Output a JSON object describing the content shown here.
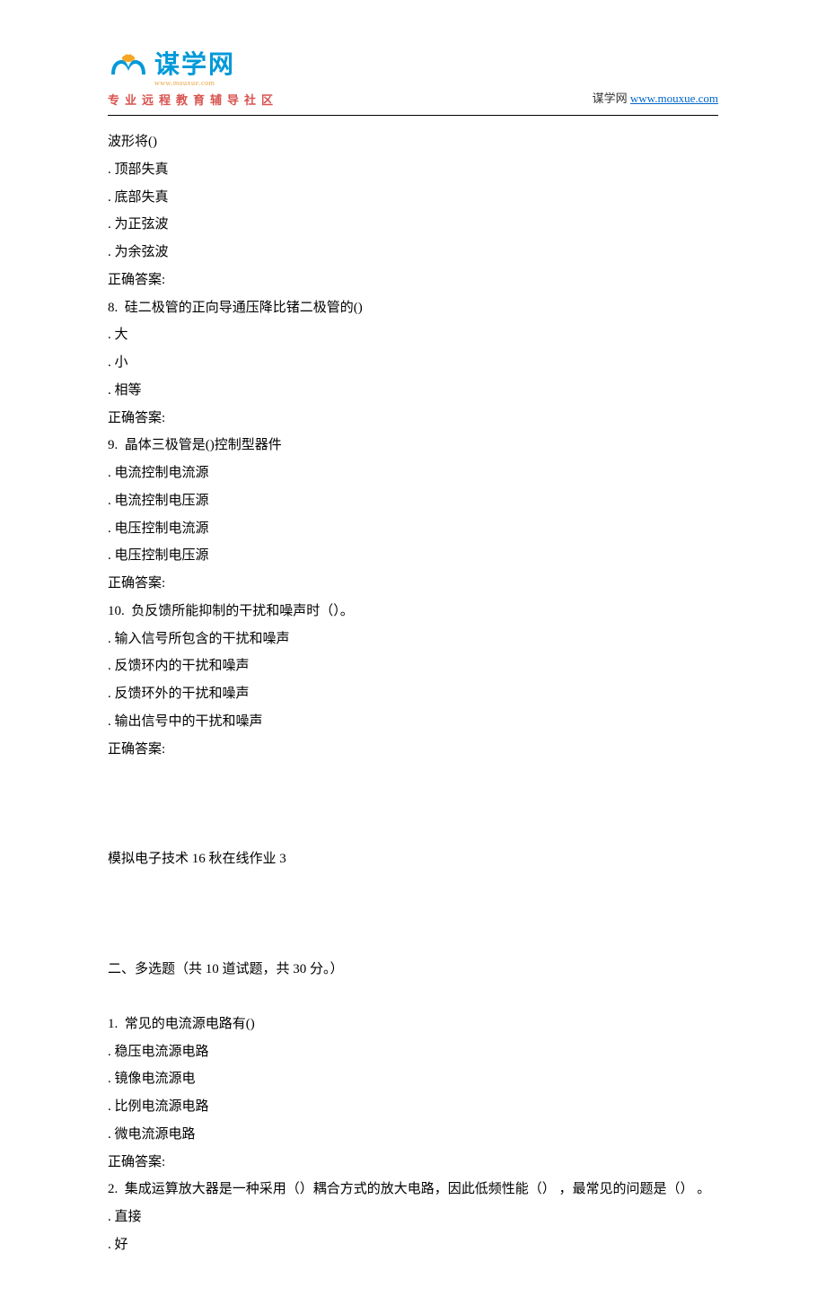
{
  "header": {
    "logo_main": "谋学网",
    "logo_sub": "www.mouxue.com",
    "logo_slogan": "专业远程教育辅导社区",
    "site_label": "谋学网",
    "site_url": "www.mouxue.com"
  },
  "lines": [
    "波形将()",
    ". 顶部失真",
    ". 底部失真",
    ". 为正弦波",
    ". 为余弦波",
    "正确答案:",
    "8.  硅二极管的正向导通压降比锗二极管的()",
    ". 大",
    ". 小",
    ". 相等",
    "正确答案:",
    "9.  晶体三极管是()控制型器件",
    ". 电流控制电流源",
    ". 电流控制电压源",
    ". 电压控制电流源",
    ". 电压控制电压源",
    "正确答案:",
    "10.  负反馈所能抑制的干扰和噪声时（）。",
    ". 输入信号所包含的干扰和噪声",
    ". 反馈环内的干扰和噪声",
    ". 反馈环外的干扰和噪声",
    ". 输出信号中的干扰和噪声",
    "正确答案:"
  ],
  "section_title": "模拟电子技术 16 秋在线作业 3",
  "section2_heading": "二、多选题（共 10 道试题，共 30 分。）",
  "lines2": [
    "1.  常见的电流源电路有()",
    ". 稳压电流源电路",
    ". 镜像电流源电",
    ". 比例电流源电路",
    ". 微电流源电路",
    "正确答案:",
    "2.  集成运算放大器是一种采用（）耦合方式的放大电路，因此低频性能（） ，最常见的问题是（） 。",
    ". 直接",
    ". 好"
  ]
}
